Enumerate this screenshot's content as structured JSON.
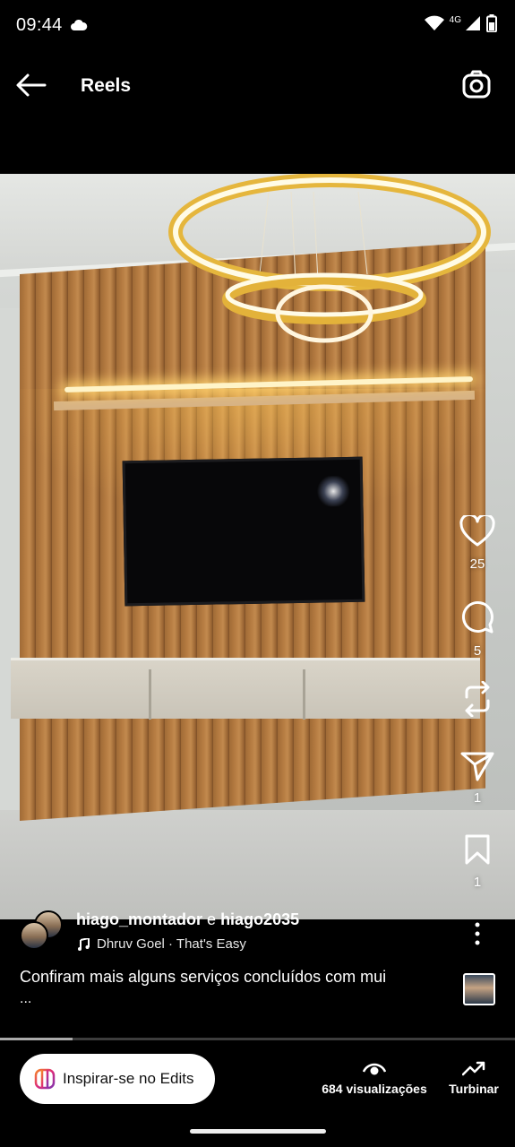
{
  "status_bar": {
    "time": "09:44",
    "network": "4G"
  },
  "header": {
    "title": "Reels"
  },
  "actions": {
    "likes": "25",
    "comments": "5",
    "shares": "1",
    "saves": "1"
  },
  "post": {
    "user1": "hiago_montador",
    "joiner": "e",
    "user2": "hiago2035",
    "audio": "Dhruv Goel · That's Easy",
    "caption": "Confiram mais alguns serviços concluídos com mui",
    "caption_more": "..."
  },
  "playback": {
    "progress": 0.14
  },
  "bottom": {
    "edits_label": "Inspirar-se no Edits",
    "views": "684 visualizações",
    "boost": "Turbinar"
  }
}
